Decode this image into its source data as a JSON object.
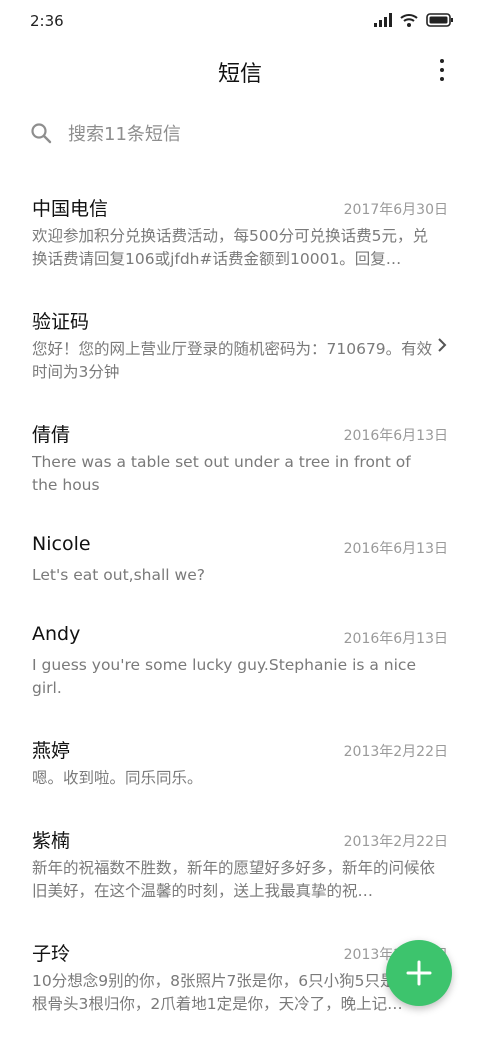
{
  "status": {
    "time": "2:36"
  },
  "header": {
    "title": "短信"
  },
  "search": {
    "placeholder": "搜索11条短信"
  },
  "messages": [
    {
      "name": "中国电信",
      "date": "2017年6月30日",
      "preview": "欢迎参加积分兑换话费活动，每500分可兑换话费5元，兑换话费请回复106或jfdh#话费金额到10001。回复…"
    },
    {
      "name": "验证码",
      "date": "",
      "preview": "您好！您的网上营业厅登录的随机密码为：710679。有效时间为3分钟"
    },
    {
      "name": "倩倩",
      "date": "2016年6月13日",
      "preview": "There was a table set out under a tree in front of the hous"
    },
    {
      "name": "Nicole",
      "date": "2016年6月13日",
      "preview": "Let's eat out,shall we?"
    },
    {
      "name": "Andy",
      "date": "2016年6月13日",
      "preview": "I guess you're some lucky guy.Stephanie is a nice girl."
    },
    {
      "name": "燕婷",
      "date": "2013年2月22日",
      "preview": "嗯。收到啦。同乐同乐。"
    },
    {
      "name": "紫楠",
      "date": "2013年2月22日",
      "preview": "新年的祝福数不胜数，新年的愿望好多好多，新年的问候依旧美好，在这个温馨的时刻，送上我最真挚的祝…"
    },
    {
      "name": "子玲",
      "date": "2013年2月22日",
      "preview": "10分想念9别的你，8张照片7张是你，6只小狗5只是你，4根骨头3根归你，2爪着地1定是你，天冷了，晚上记…"
    }
  ],
  "colors": {
    "accent": "#3dc46d",
    "secondary_text": "#9a9a9a"
  },
  "icons": {
    "search": "search-icon",
    "more": "more-vert-icon",
    "compose": "plus-icon",
    "chevron": "chevron-right-icon"
  }
}
